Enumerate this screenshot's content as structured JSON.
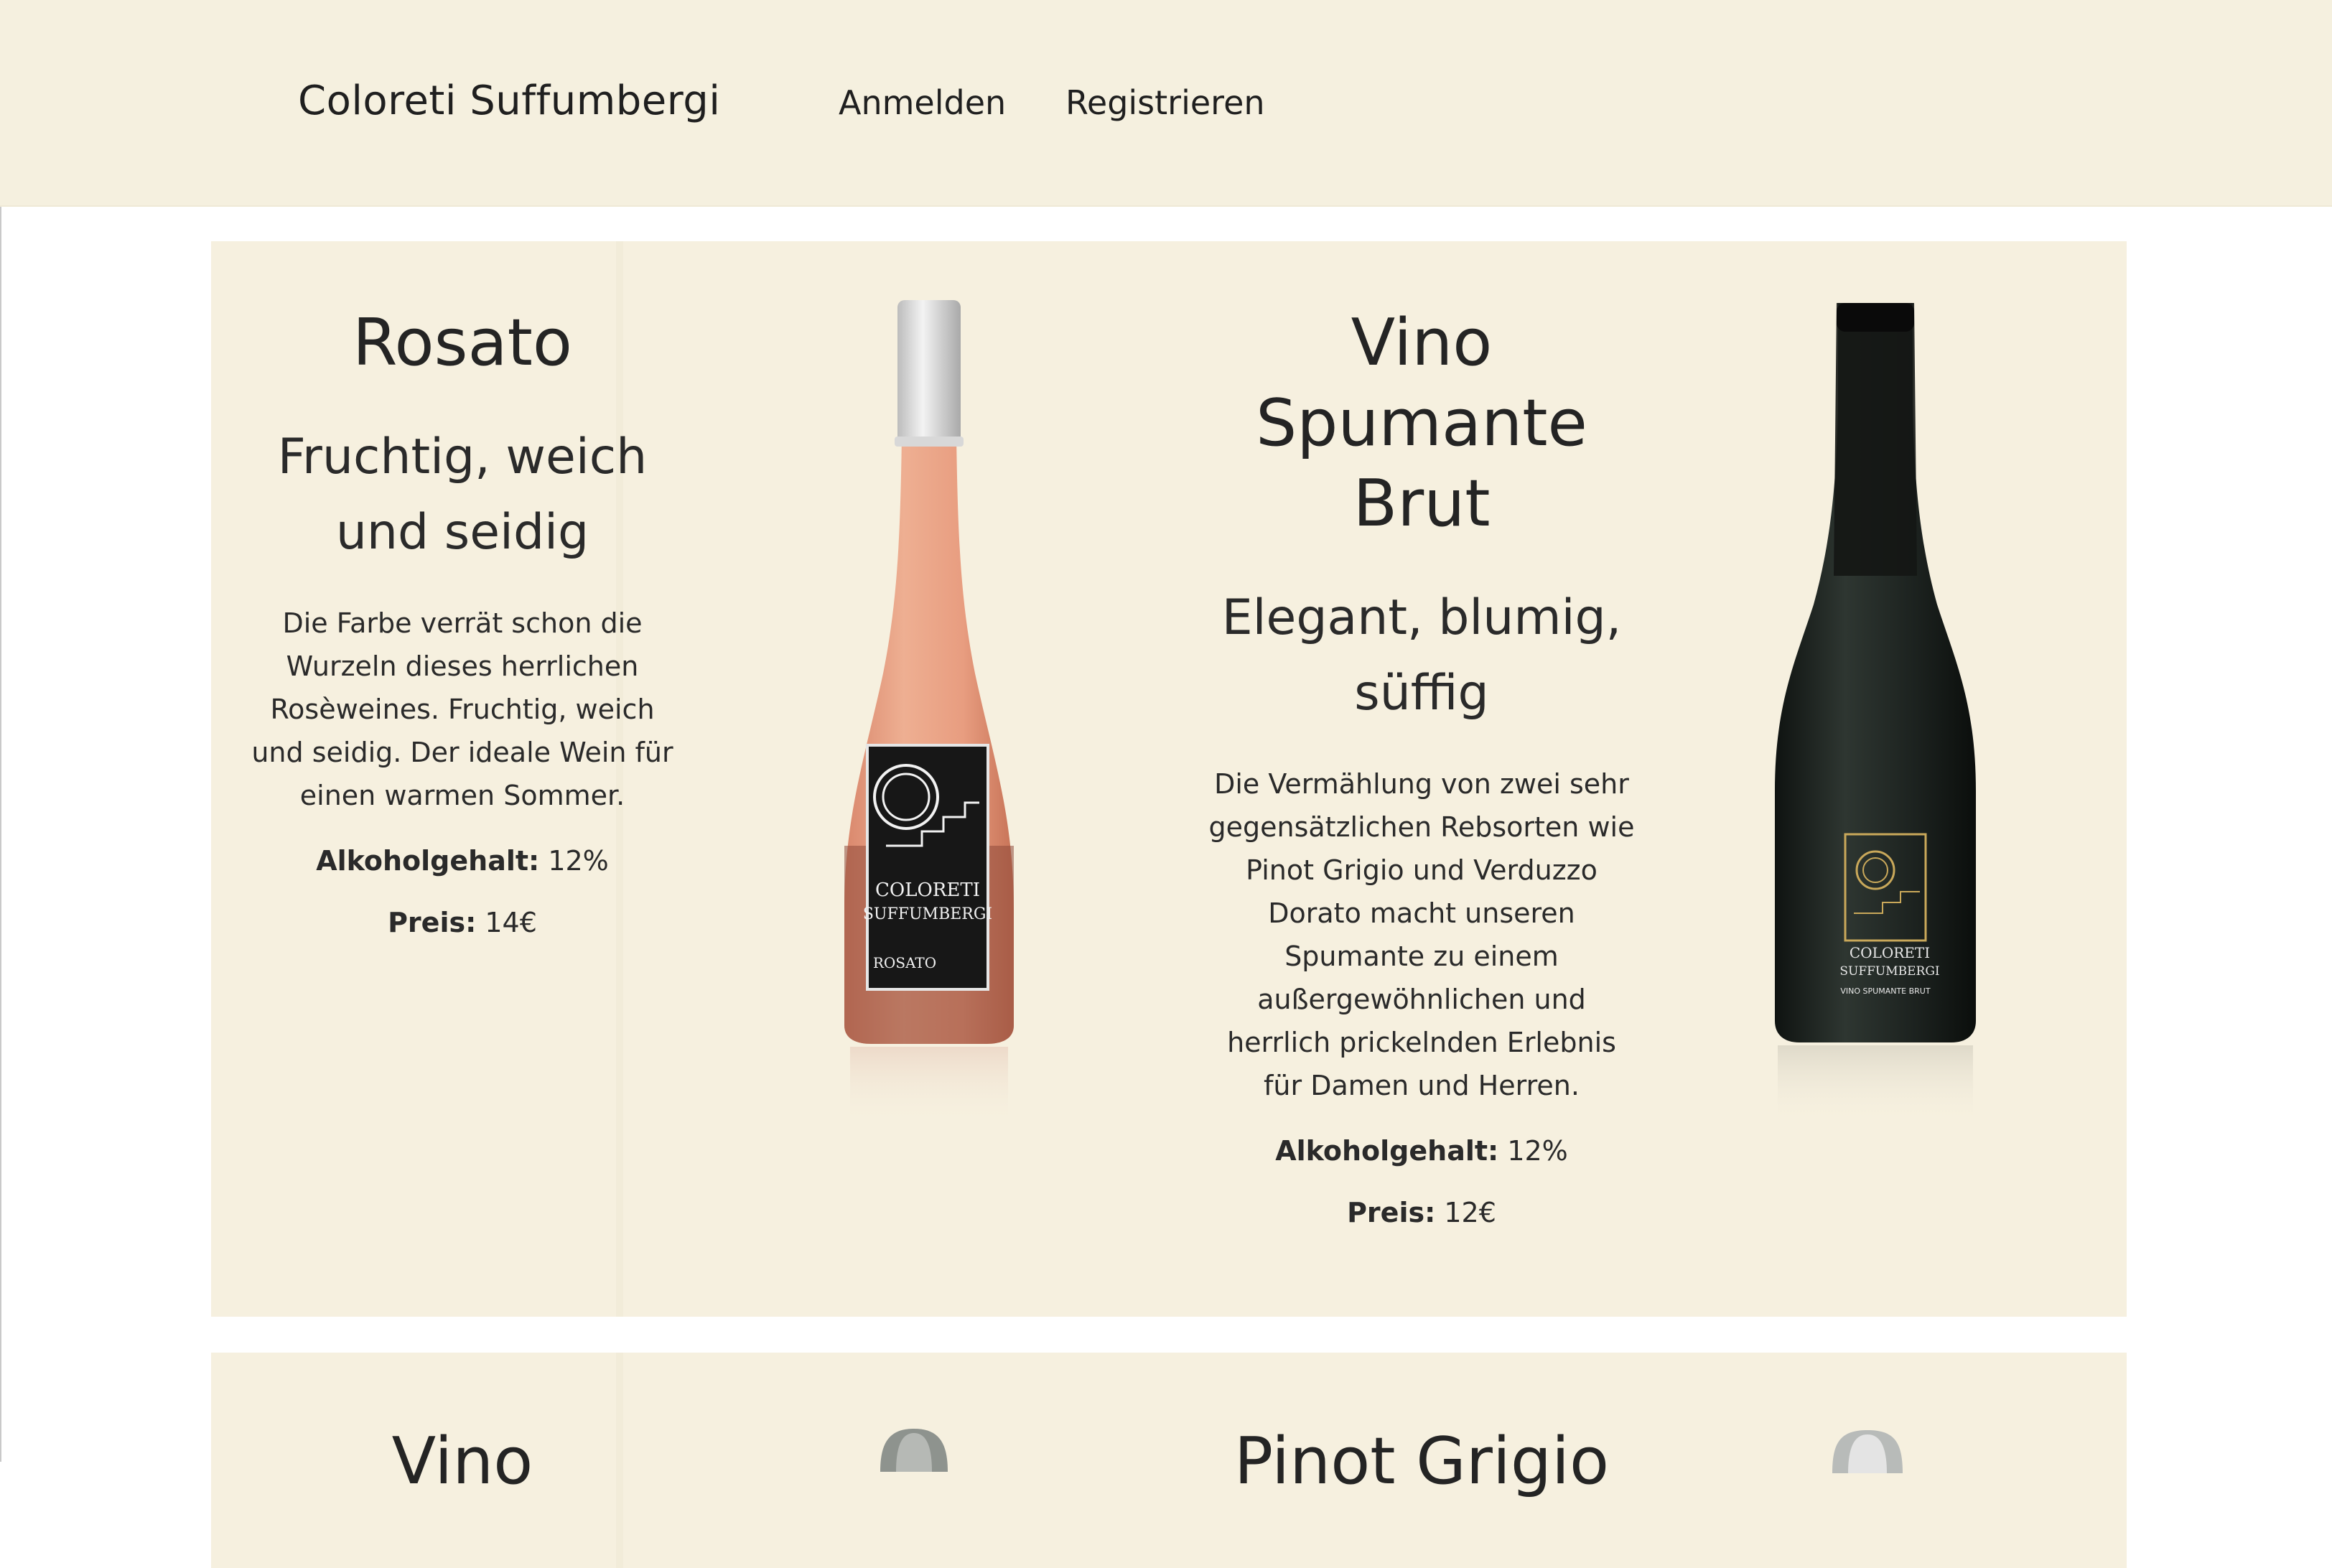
{
  "header": {
    "brand": "Coloreti Suffumbergi",
    "nav": {
      "login": "Anmelden",
      "register": "Registrieren"
    }
  },
  "wines": [
    {
      "title": "Rosato",
      "subtitle_line1": "Fruchtig, weich",
      "subtitle_line2": "und seidig",
      "description": [
        "Die Farbe verrät schon die",
        "Wurzeln dieses herrlichen",
        "Rosèweines. Fruchtig, weich",
        "und seidig. Der ideale Wein für",
        "einen warmen Sommer."
      ],
      "alcohol_label": "Alkoholgehalt:",
      "alcohol_value": "12%",
      "price_label": "Preis:",
      "price_value": "14€",
      "bottle_label": {
        "line1": "COLORETI",
        "line2": "SUFFUMBERGI",
        "line3": "ROSATO"
      }
    },
    {
      "title_lines": [
        "Vino",
        "Spumante",
        "Brut"
      ],
      "subtitle_line1": "Elegant, blumig,",
      "subtitle_line2": "süffig",
      "description": [
        "Die Vermählung von zwei sehr",
        "gegensätzlichen Rebsorten wie",
        "Pinot Grigio und Verduzzo",
        "Dorato macht unseren",
        "Spumante zu einem",
        "außergewöhnlichen und",
        "herrlich prickelnden Erlebnis",
        "für Damen und Herren."
      ],
      "alcohol_label": "Alkoholgehalt:",
      "alcohol_value": "12%",
      "price_label": "Preis:",
      "price_value": "12€",
      "bottle_label": {
        "line1": "COLORETI",
        "line2": "SUFFUMBERGI",
        "line3": "VINO SPUMANTE BRUT"
      }
    },
    {
      "title": "Vino"
    },
    {
      "title": "Pinot Grigio"
    }
  ],
  "colors": {
    "header_bg": "#f5f0df",
    "card_bg": "#f6f0df",
    "text": "#242424",
    "rose_wine": "#e7a284",
    "sparkling_bottle": "#1e2420"
  }
}
